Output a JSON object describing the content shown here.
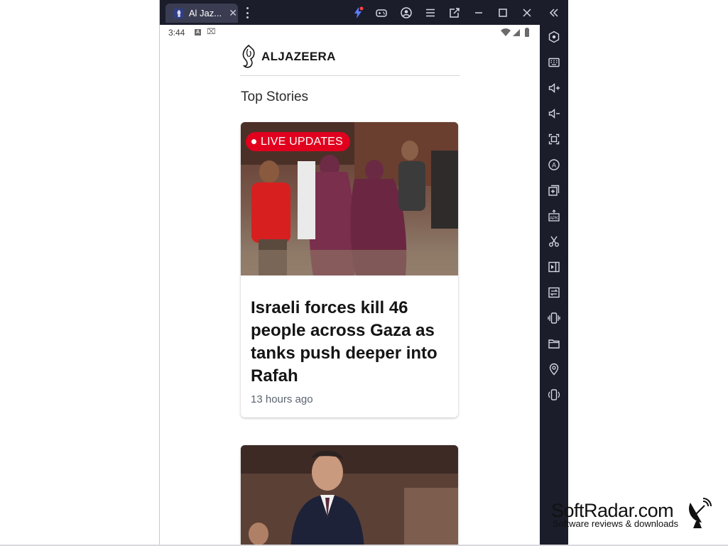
{
  "window": {
    "tab_title": "Al Jaz...",
    "tab_close": "✕",
    "colors": {
      "chrome": "#1b1d2b",
      "tab": "#3a3d52",
      "accent": "#e1001e"
    }
  },
  "toolbar_icons": [
    "lightning-icon",
    "gamepad-icon",
    "account-icon",
    "menu-icon",
    "external-window-icon",
    "minimize-icon",
    "maximize-icon",
    "close-icon",
    "collapse-sidebar-icon"
  ],
  "sidebar_icons": [
    "settings-icon",
    "keyboard-icon",
    "volume-up-icon",
    "volume-down-icon",
    "screenshot-icon",
    "auto-rotate-icon",
    "add-instance-icon",
    "apk-install-icon",
    "cut-icon",
    "media-icon",
    "sync-icon",
    "shake-icon",
    "folder-icon",
    "location-icon",
    "rotate-icon"
  ],
  "status_bar": {
    "time": "3:44",
    "a_icon": "A",
    "x_icon": "⌧"
  },
  "app": {
    "brand_name": "ALJAZEERA",
    "section_title": "Top Stories",
    "stories": [
      {
        "badge": "LIVE UPDATES",
        "headline": "Israeli forces kill 46 people across Gaza as tanks push deeper into Rafah",
        "time_ago": "13 hours ago"
      }
    ]
  },
  "watermark": {
    "title": "SoftRadar.com",
    "subtitle": "Software reviews & downloads"
  }
}
